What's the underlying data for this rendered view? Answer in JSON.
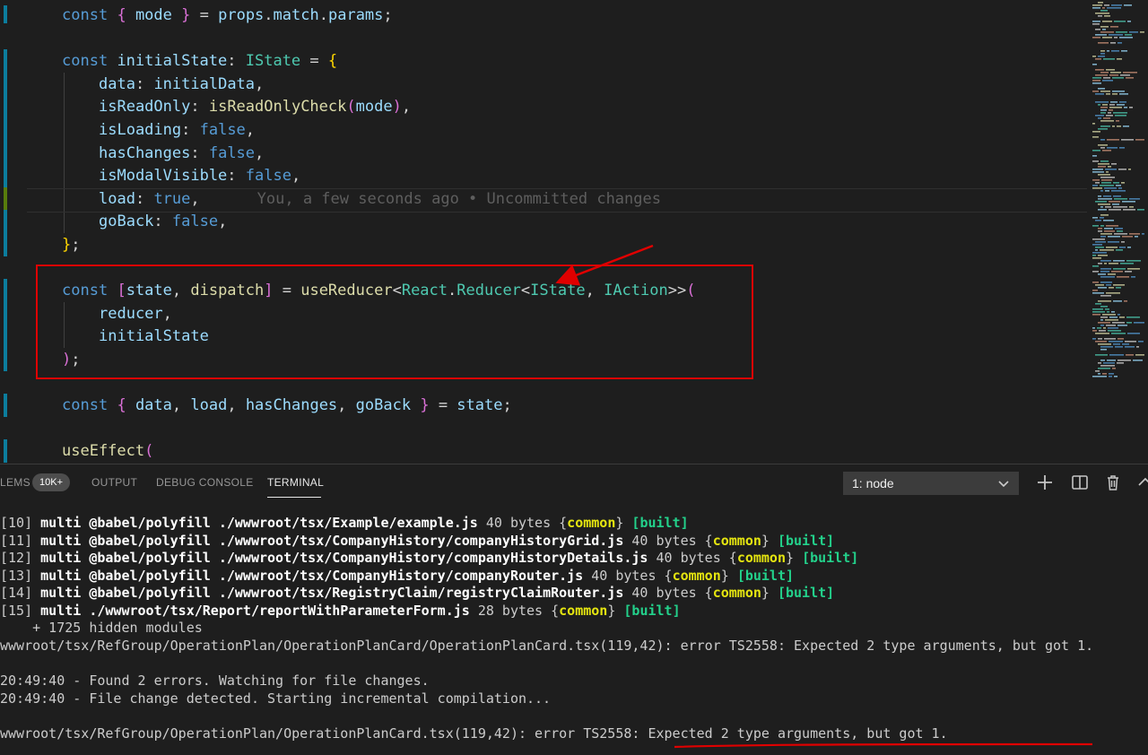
{
  "editor": {
    "lines": [
      {
        "indent": 0,
        "tokens": [
          [
            "kw",
            "const"
          ],
          [
            "plain",
            " "
          ],
          [
            "paren",
            "{"
          ],
          [
            "plain",
            " "
          ],
          [
            "var",
            "mode"
          ],
          [
            "plain",
            " "
          ],
          [
            "paren",
            "}"
          ],
          [
            "plain",
            " = "
          ],
          [
            "var",
            "props"
          ],
          [
            "plain",
            "."
          ],
          [
            "var",
            "match"
          ],
          [
            "plain",
            "."
          ],
          [
            "var",
            "params"
          ],
          [
            "plain",
            ";"
          ]
        ]
      },
      {
        "indent": 0,
        "tokens": []
      },
      {
        "indent": 0,
        "tokens": [
          [
            "kw",
            "const"
          ],
          [
            "plain",
            " "
          ],
          [
            "var",
            "initialState"
          ],
          [
            "plain",
            ": "
          ],
          [
            "type",
            "IState"
          ],
          [
            "plain",
            " = "
          ],
          [
            "brace",
            "{"
          ]
        ]
      },
      {
        "indent": 1,
        "tokens": [
          [
            "var",
            "data"
          ],
          [
            "plain",
            ": "
          ],
          [
            "var",
            "initialData"
          ],
          [
            "plain",
            ","
          ]
        ]
      },
      {
        "indent": 1,
        "tokens": [
          [
            "var",
            "isReadOnly"
          ],
          [
            "plain",
            ": "
          ],
          [
            "fn",
            "isReadOnlyCheck"
          ],
          [
            "paren",
            "("
          ],
          [
            "var",
            "mode"
          ],
          [
            "paren",
            ")"
          ],
          [
            "plain",
            ","
          ]
        ]
      },
      {
        "indent": 1,
        "tokens": [
          [
            "var",
            "isLoading"
          ],
          [
            "plain",
            ": "
          ],
          [
            "kw",
            "false"
          ],
          [
            "plain",
            ","
          ]
        ]
      },
      {
        "indent": 1,
        "tokens": [
          [
            "var",
            "hasChanges"
          ],
          [
            "plain",
            ": "
          ],
          [
            "kw",
            "false"
          ],
          [
            "plain",
            ","
          ]
        ]
      },
      {
        "indent": 1,
        "tokens": [
          [
            "var",
            "isModalVisible"
          ],
          [
            "plain",
            ": "
          ],
          [
            "kw",
            "false"
          ],
          [
            "plain",
            ","
          ]
        ]
      },
      {
        "indent": 1,
        "tokens": [
          [
            "var",
            "load"
          ],
          [
            "plain",
            ": "
          ],
          [
            "kw",
            "true"
          ],
          [
            "plain",
            ","
          ]
        ],
        "blame": "You, a few seconds ago • Uncommitted changes"
      },
      {
        "indent": 1,
        "tokens": [
          [
            "var",
            "goBack"
          ],
          [
            "plain",
            ": "
          ],
          [
            "kw",
            "false"
          ],
          [
            "plain",
            ","
          ]
        ]
      },
      {
        "indent": 0,
        "tokens": [
          [
            "brace",
            "}"
          ],
          [
            "plain",
            ";"
          ]
        ]
      },
      {
        "indent": 0,
        "tokens": []
      },
      {
        "indent": 0,
        "tokens": [
          [
            "kw",
            "const"
          ],
          [
            "plain",
            " "
          ],
          [
            "paren",
            "["
          ],
          [
            "var",
            "state"
          ],
          [
            "plain",
            ", "
          ],
          [
            "fn",
            "dispatch"
          ],
          [
            "paren",
            "]"
          ],
          [
            "plain",
            " = "
          ],
          [
            "fn",
            "useReducer"
          ],
          [
            "plain",
            "<"
          ],
          [
            "type",
            "React"
          ],
          [
            "plain",
            "."
          ],
          [
            "type",
            "Reducer"
          ],
          [
            "plain",
            "<"
          ],
          [
            "type",
            "IState"
          ],
          [
            "plain",
            ", "
          ],
          [
            "type",
            "IAction"
          ],
          [
            "plain",
            ">>"
          ],
          [
            "paren",
            "("
          ]
        ]
      },
      {
        "indent": 1,
        "tokens": [
          [
            "var",
            "reducer"
          ],
          [
            "plain",
            ","
          ]
        ]
      },
      {
        "indent": 1,
        "tokens": [
          [
            "var",
            "initialState"
          ]
        ]
      },
      {
        "indent": 0,
        "tokens": [
          [
            "paren",
            ")"
          ],
          [
            "plain",
            ";"
          ]
        ]
      },
      {
        "indent": 0,
        "tokens": []
      },
      {
        "indent": 0,
        "tokens": [
          [
            "kw",
            "const"
          ],
          [
            "plain",
            " "
          ],
          [
            "paren",
            "{"
          ],
          [
            "plain",
            " "
          ],
          [
            "var",
            "data"
          ],
          [
            "plain",
            ", "
          ],
          [
            "var",
            "load"
          ],
          [
            "plain",
            ", "
          ],
          [
            "var",
            "hasChanges"
          ],
          [
            "plain",
            ", "
          ],
          [
            "var",
            "goBack"
          ],
          [
            "plain",
            " "
          ],
          [
            "paren",
            "}"
          ],
          [
            "plain",
            " = "
          ],
          [
            "var",
            "state"
          ],
          [
            "plain",
            ";"
          ]
        ]
      },
      {
        "indent": 0,
        "tokens": []
      },
      {
        "indent": 0,
        "tokens": [
          [
            "fn",
            "useEffect"
          ],
          [
            "paren",
            "("
          ]
        ]
      }
    ]
  },
  "panel": {
    "tabs": [
      {
        "label": "LEMS",
        "active": false
      },
      {
        "label": "OUTPUT",
        "active": false
      },
      {
        "label": "DEBUG CONSOLE",
        "active": false
      },
      {
        "label": "TERMINAL",
        "active": true
      }
    ],
    "problems_badge": "10K+",
    "terminal_select": "1: node",
    "icons": [
      "plus-icon",
      "split-icon",
      "trash-icon",
      "chevron-up-icon"
    ]
  },
  "terminal": {
    "lines": [
      [
        [
          "",
          "[10] "
        ],
        [
          "tb",
          "multi @babel/polyfill ./wwwroot/tsx/Example/example.js"
        ],
        [
          "",
          " 40 bytes {"
        ],
        [
          "ty",
          "common"
        ],
        [
          "",
          "} "
        ],
        [
          "tg",
          "[built]"
        ]
      ],
      [
        [
          "",
          "[11] "
        ],
        [
          "tb",
          "multi @babel/polyfill ./wwwroot/tsx/CompanyHistory/companyHistoryGrid.js"
        ],
        [
          "",
          " 40 bytes {"
        ],
        [
          "ty",
          "common"
        ],
        [
          "",
          "} "
        ],
        [
          "tg",
          "[built]"
        ]
      ],
      [
        [
          "",
          "[12] "
        ],
        [
          "tb",
          "multi @babel/polyfill ./wwwroot/tsx/CompanyHistory/companyHistoryDetails.js"
        ],
        [
          "",
          " 40 bytes {"
        ],
        [
          "ty",
          "common"
        ],
        [
          "",
          "} "
        ],
        [
          "tg",
          "[built]"
        ]
      ],
      [
        [
          "",
          "[13] "
        ],
        [
          "tb",
          "multi @babel/polyfill ./wwwroot/tsx/CompanyHistory/companyRouter.js"
        ],
        [
          "",
          " 40 bytes {"
        ],
        [
          "ty",
          "common"
        ],
        [
          "",
          "} "
        ],
        [
          "tg",
          "[built]"
        ]
      ],
      [
        [
          "",
          "[14] "
        ],
        [
          "tb",
          "multi @babel/polyfill ./wwwroot/tsx/RegistryClaim/registryClaimRouter.js"
        ],
        [
          "",
          " 40 bytes {"
        ],
        [
          "ty",
          "common"
        ],
        [
          "",
          "} "
        ],
        [
          "tg",
          "[built]"
        ]
      ],
      [
        [
          "",
          "[15] "
        ],
        [
          "tb",
          "multi ./wwwroot/tsx/Report/reportWithParameterForm.js"
        ],
        [
          "",
          " 28 bytes {"
        ],
        [
          "ty",
          "common"
        ],
        [
          "",
          "} "
        ],
        [
          "tg",
          "[built]"
        ]
      ],
      [
        [
          "",
          "    + 1725 hidden modules"
        ]
      ],
      [
        [
          "",
          "wwwroot/tsx/RefGroup/OperationPlan/OperationPlanCard/OperationPlanCard.tsx(119,42): error TS2558: Expected 2 type arguments, but got 1."
        ]
      ],
      [],
      [
        [
          "",
          "20:49:40 - Found 2 errors. Watching for file changes."
        ]
      ],
      [
        [
          "",
          "20:49:40 - File change detected. Starting incremental compilation..."
        ]
      ],
      [],
      [
        [
          "",
          "wwwroot/tsx/RefGroup/OperationPlan/OperationPlanCard.tsx(119,42): error TS2558: Expected 2 type arguments, but got 1."
        ]
      ]
    ]
  },
  "colors": {
    "annotation": "#e00000",
    "git_modified": "#0c7d9d",
    "git_added": "#587c0c"
  }
}
